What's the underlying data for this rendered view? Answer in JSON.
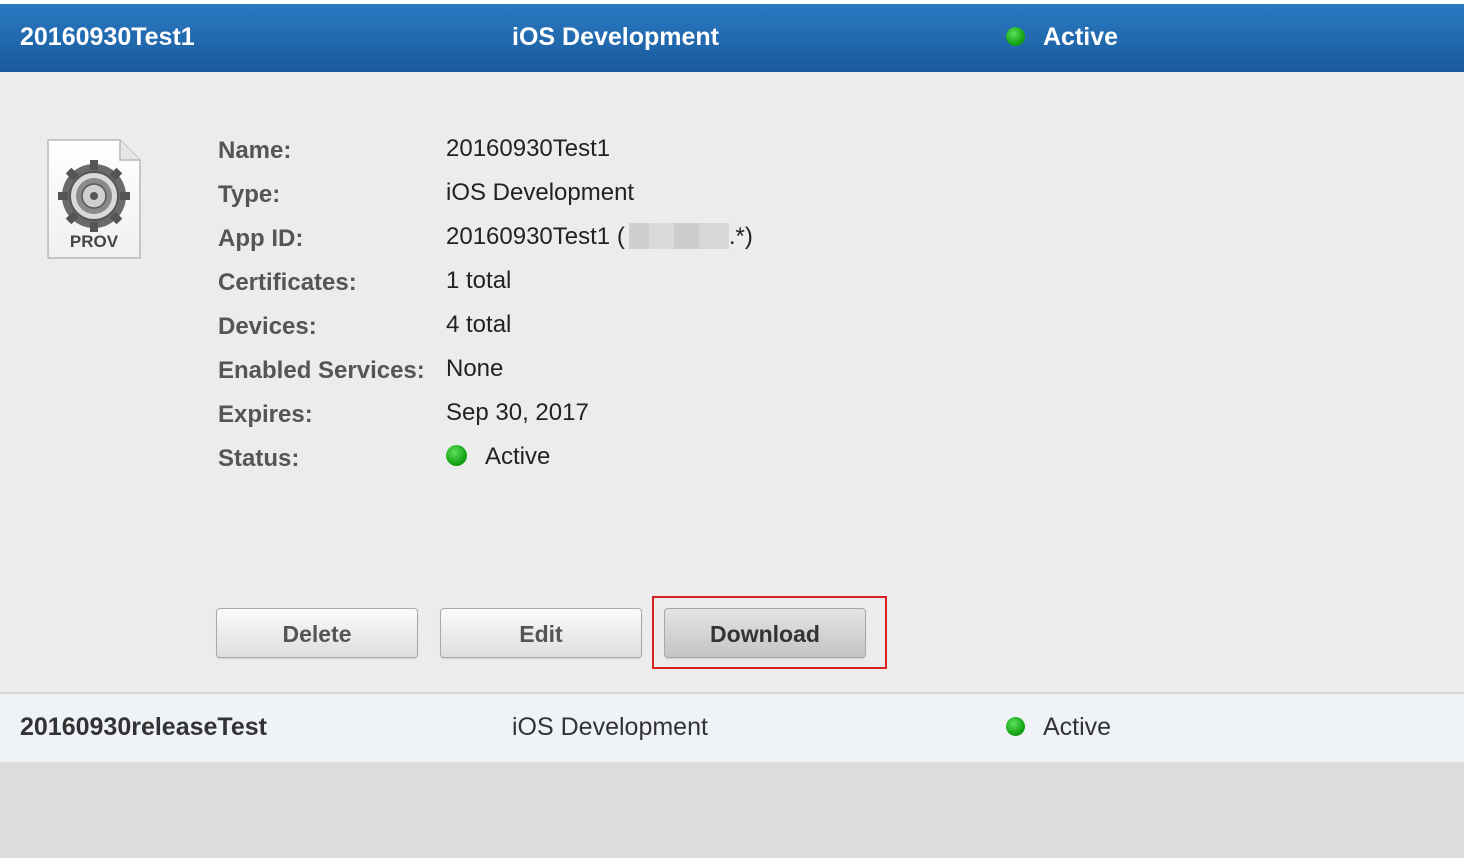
{
  "selected_profile": {
    "name": "20160930Test1",
    "type": "iOS Development",
    "status": "Active"
  },
  "detail": {
    "icon": {
      "name": "prov-file-icon",
      "label": "PROV"
    },
    "fields": [
      {
        "label": "Name:",
        "value": "20160930Test1"
      },
      {
        "label": "Type:",
        "value": "iOS Development"
      },
      {
        "label": "App ID:",
        "value_prefix": "20160930Test1 (",
        "value_suffix": ".*)"
      },
      {
        "label": "Certificates:",
        "value": "1 total"
      },
      {
        "label": "Devices:",
        "value": "4 total"
      },
      {
        "label": "Enabled Services:",
        "value": "None"
      },
      {
        "label": "Expires:",
        "value": "Sep 30, 2017"
      },
      {
        "label": "Status:",
        "value": "Active"
      }
    ],
    "buttons": {
      "delete": "Delete",
      "edit": "Edit",
      "download": "Download"
    }
  },
  "other_profile": {
    "name": "20160930releaseTest",
    "type": "iOS Development",
    "status": "Active"
  },
  "colors": {
    "header_blue": "#1f6aae",
    "status_green": "#16a516",
    "highlight_red": "#d62020"
  }
}
